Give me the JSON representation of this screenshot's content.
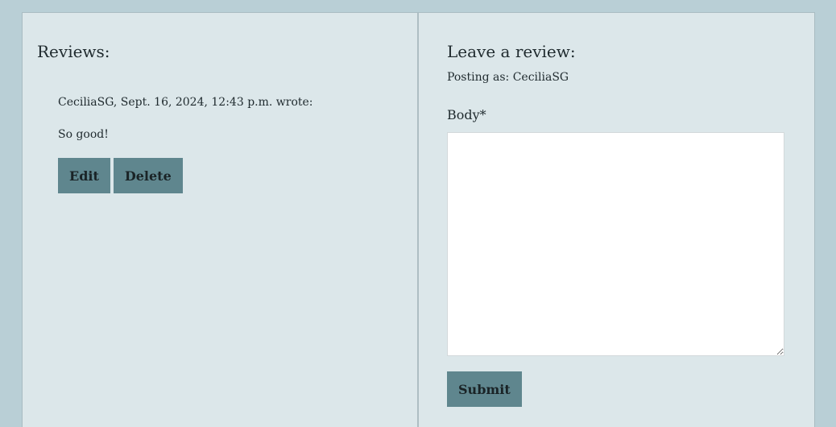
{
  "reviews_section": {
    "heading": "Reviews:",
    "reviews": [
      {
        "meta": "CeciliaSG, Sept. 16, 2024, 12:43 p.m. wrote:",
        "body": "So good!",
        "edit_label": "Edit",
        "delete_label": "Delete"
      }
    ]
  },
  "review_form": {
    "heading": "Leave a review:",
    "posting_as": "Posting as: CeciliaSG",
    "body_label": "Body*",
    "body_value": "",
    "submit_label": "Submit"
  },
  "colors": {
    "page_background": "#b9cfd6",
    "panel_background": "#dce7ea",
    "button": "#5f868e"
  }
}
